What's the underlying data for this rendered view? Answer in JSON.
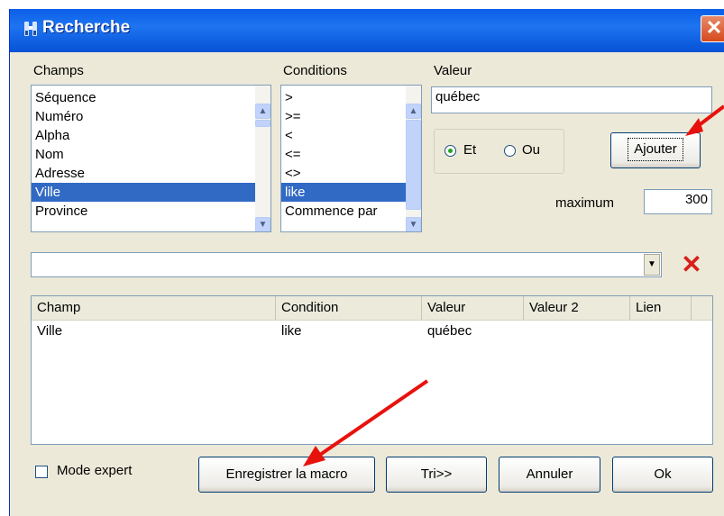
{
  "window": {
    "title": "Recherche",
    "close_label": "✕"
  },
  "fields": {
    "champs_label": "Champs",
    "conditions_label": "Conditions",
    "valeur_label": "Valeur",
    "champs_items": [
      "Séquence",
      "Numéro",
      "Alpha",
      "Nom",
      "Adresse",
      "Ville",
      "Province"
    ],
    "champs_selected": "Ville",
    "conditions_items": [
      ">",
      ">=",
      "<",
      "<=",
      "<>",
      "like",
      "Commence par"
    ],
    "conditions_selected": "like",
    "valeur_value": "québec"
  },
  "logic": {
    "et_label": "Et",
    "ou_label": "Ou",
    "selected": "Et"
  },
  "buttons": {
    "ajouter": "Ajouter",
    "enregistrer": "Enregistrer la macro",
    "tri": "Tri>>",
    "annuler": "Annuler",
    "ok": "Ok"
  },
  "maximum": {
    "label": "maximum",
    "value": "300"
  },
  "expression": {
    "value": "",
    "delete_label": "✕"
  },
  "table": {
    "columns": [
      "Champ",
      "Condition",
      "Valeur",
      "Valeur 2",
      "Lien"
    ],
    "rows": [
      {
        "champ": "Ville",
        "condition": "like",
        "valeur": "québec",
        "valeur2": "",
        "lien": ""
      }
    ]
  },
  "mode_expert": {
    "label": "Mode expert",
    "checked": false
  },
  "colors": {
    "title_bar": "#0a5fe8",
    "selection": "#316ac5",
    "annotation_arrow": "#e8120c",
    "delete_icon": "#d8201a"
  }
}
